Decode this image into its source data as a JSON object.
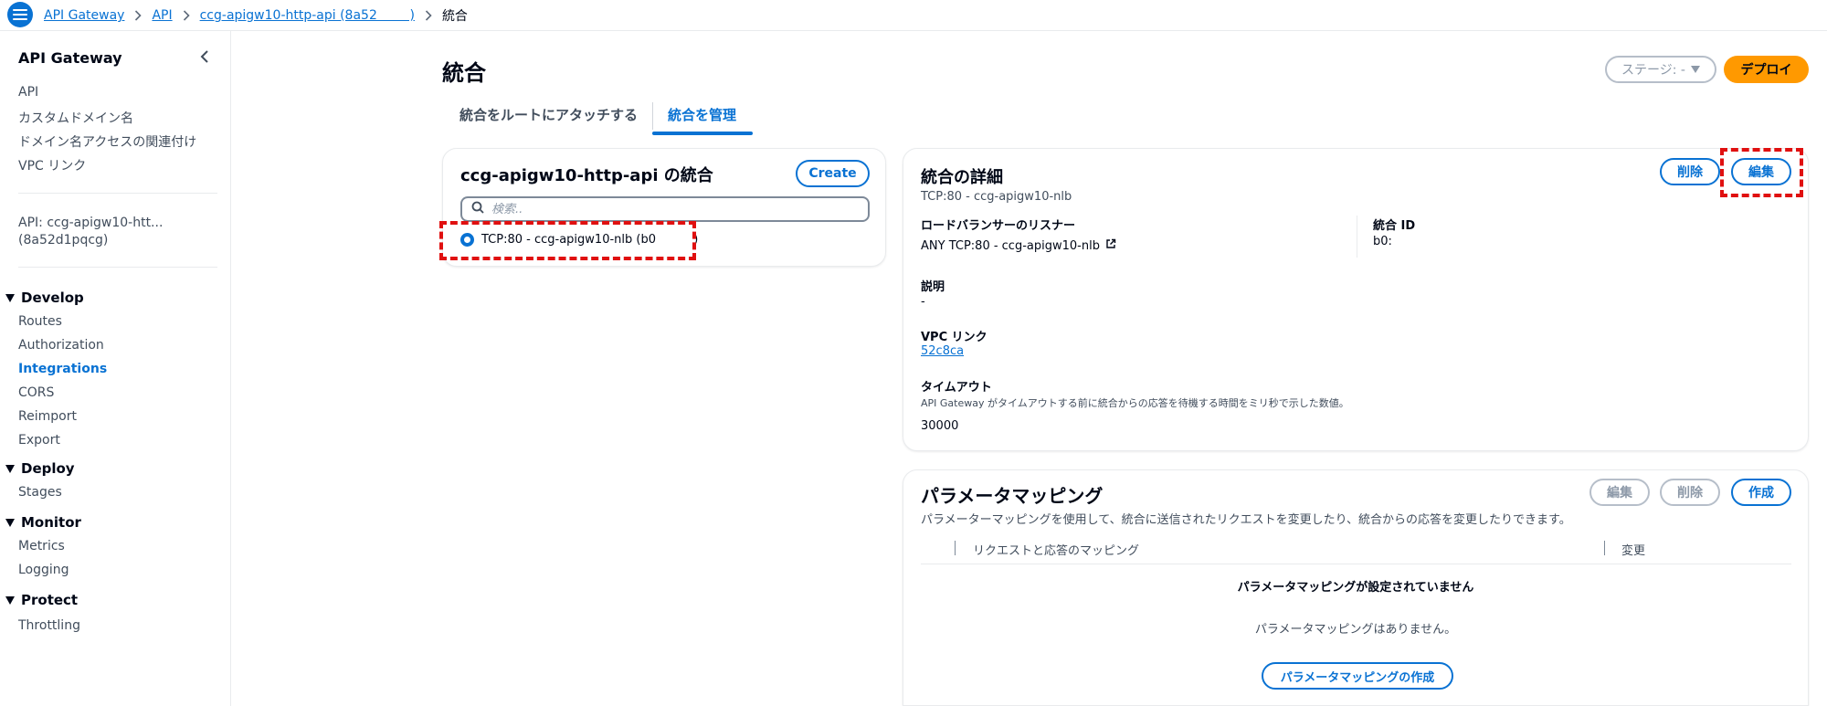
{
  "breadcrumb": {
    "items": [
      "API Gateway",
      "API",
      "ccg-apigw10-http-api (8a52        )"
    ],
    "current": "統合"
  },
  "sidebar": {
    "title": "API Gateway",
    "links": [
      "API",
      "カスタムドメイン名",
      "ドメイン名アクセスの関連付け",
      "VPC リンク"
    ],
    "api_line1": "API: ccg-apigw10-htt...",
    "api_line2": "(8a52d1pqcg)",
    "sections": [
      {
        "label": "Develop",
        "items": [
          "Routes",
          "Authorization",
          "Integrations",
          "CORS",
          "Reimport",
          "Export"
        ]
      },
      {
        "label": "Deploy",
        "items": [
          "Stages"
        ]
      },
      {
        "label": "Monitor",
        "items": [
          "Metrics",
          "Logging"
        ]
      },
      {
        "label": "Protect",
        "items": [
          "Throttling"
        ]
      }
    ],
    "active_item": "Integrations"
  },
  "header": {
    "title": "統合",
    "stage_label": "ステージ: -",
    "deploy_label": "デプロイ"
  },
  "tabs": [
    {
      "label": "統合をルートにアタッチする",
      "active": false
    },
    {
      "label": "統合を管理",
      "active": true
    }
  ],
  "integrations_panel": {
    "title": "ccg-apigw10-http-api の統合",
    "create_label": "Create",
    "search_placeholder": "検索..",
    "items": [
      {
        "label": "TCP:80 - ccg-apigw10-nlb (b0          )",
        "selected": true
      }
    ]
  },
  "details_panel": {
    "title": "統合の詳細",
    "subtitle": "TCP:80 - ccg-apigw10-nlb",
    "delete_label": "削除",
    "edit_label": "編集",
    "listener_label": "ロードバランサーのリスナー",
    "listener_value": "ANY TCP:80 - ccg-apigw10-nlb",
    "integration_id_label": "統合 ID",
    "integration_id_value": "b0:",
    "description_label": "説明",
    "description_value": "-",
    "vpc_link_label": "VPC リンク",
    "vpc_link_value": "52c8ca",
    "timeout_label": "タイムアウト",
    "timeout_help": "API Gateway がタイムアウトする前に統合からの応答を待機する時間をミリ秒で示した数値。",
    "timeout_value": "30000"
  },
  "mapping_panel": {
    "title": "パラメータマッピング",
    "description": "パラメーターマッピングを使用して、統合に送信されたリクエストを変更したり、統合からの応答を変更したりできます。",
    "edit_label": "編集",
    "delete_label": "削除",
    "create_label": "作成",
    "columns": [
      "リクエストと応答のマッピング",
      "変更"
    ],
    "empty_title": "パラメータマッピングが設定されていません",
    "empty_body": "パラメータマッピングはありません。",
    "create_mapping_label": "パラメータマッピングの作成"
  },
  "colors": {
    "accent": "#0972d3",
    "deploy": "#ff9900",
    "highlight": "#e01010"
  }
}
